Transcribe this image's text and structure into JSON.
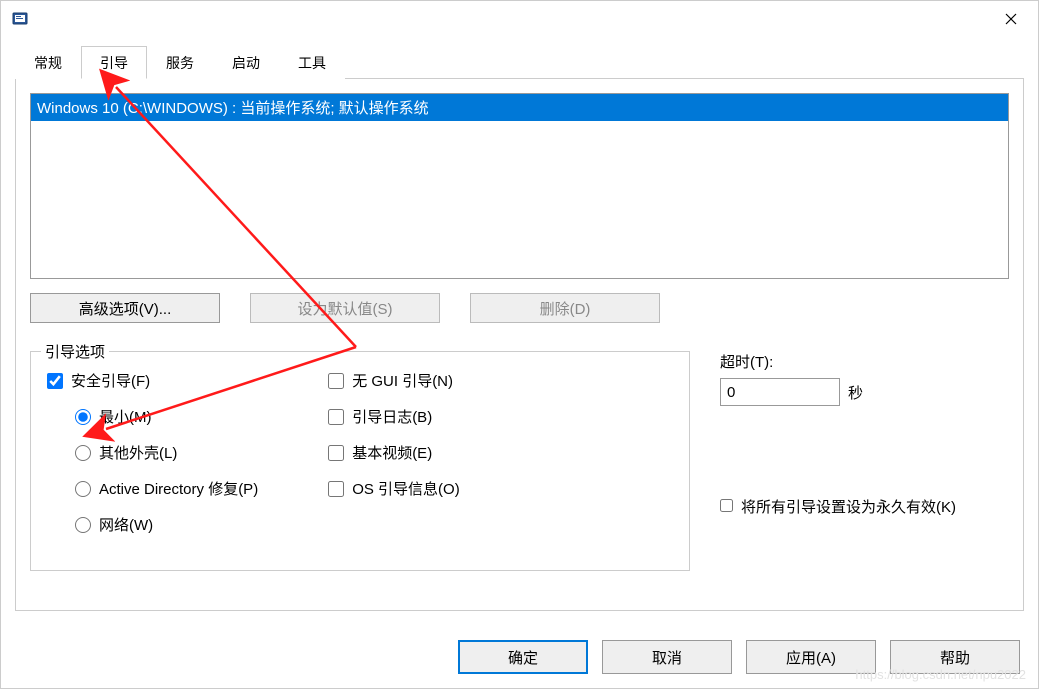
{
  "tabs": [
    "常规",
    "引导",
    "服务",
    "启动",
    "工具"
  ],
  "active_tab_index": 1,
  "os_list_item": "Windows 10 (C:\\WINDOWS) : 当前操作系统; 默认操作系统",
  "buttons": {
    "advanced": "高级选项(V)...",
    "set_default": "设为默认值(S)",
    "delete": "删除(D)"
  },
  "boot_options": {
    "title": "引导选项",
    "safe_boot": "安全引导(F)",
    "minimal": "最小(M)",
    "other_shell": "其他外壳(L)",
    "ad_repair": "Active Directory 修复(P)",
    "network": "网络(W)",
    "no_gui": "无 GUI 引导(N)",
    "boot_log": "引导日志(B)",
    "basic_video": "基本视频(E)",
    "os_boot_info": "OS 引导信息(O)"
  },
  "timeout": {
    "label": "超时(T):",
    "value": "0",
    "unit": "秒"
  },
  "permanent": "将所有引导设置设为永久有效(K)",
  "bottom_buttons": {
    "ok": "确定",
    "cancel": "取消",
    "apply": "应用(A)",
    "help": "帮助"
  },
  "watermark": "https://blog.csdn.net/npu2022"
}
